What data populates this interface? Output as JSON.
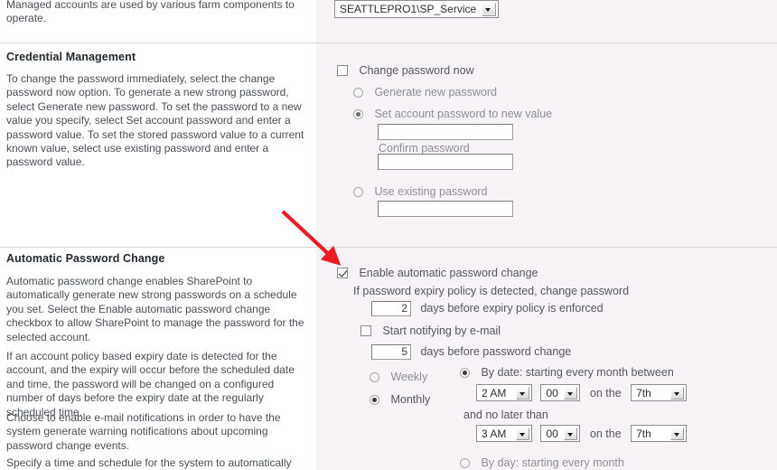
{
  "left_column": {
    "intro_text": "Managed accounts are used by various farm components to operate.",
    "sections": [
      {
        "title": "Credential Management",
        "paragraphs": [
          "To change the password immediately, select the change password now option. To generate a new strong password, select Generate new password. To set the password to a new value you specify, select Set account password and enter a password value. To set the stored password value to a current known value, select use existing password and enter a password value."
        ]
      },
      {
        "title": "Automatic Password Change",
        "paragraphs": [
          "Automatic password change enables SharePoint to automatically generate new strong passwords on a schedule you set. Select the Enable automatic password change checkbox to allow SharePoint to manage the password for the selected account.",
          "If an account policy based expiry date is detected for the account, and the expiry will occur before the scheduled date and time, the password will be changed on a configured number of days before the expiry date at the regularly scheduled time.",
          "Choose to enable e-mail notifications in order to have the system generate warning notifications about upcoming password change events.",
          "Specify a time and schedule for the system to automatically"
        ]
      }
    ]
  },
  "right_column": {
    "account_select": {
      "value": "SEATTLEPRO1\\SP_Service"
    },
    "credential_management": {
      "change_password_now": {
        "label": "Change password now",
        "checked": false
      },
      "generate_new_password": {
        "label": "Generate new password",
        "selected": false
      },
      "set_account_password": {
        "label": "Set account password to new value",
        "selected": true
      },
      "new_password_field": {
        "value": "",
        "placeholder": ""
      },
      "confirm_password_label": "Confirm password",
      "confirm_password_field": {
        "value": "",
        "placeholder": ""
      },
      "use_existing_password": {
        "label": "Use existing password",
        "selected": false
      },
      "existing_password_field": {
        "value": "",
        "placeholder": ""
      }
    },
    "automatic_password_change": {
      "enable": {
        "label": "Enable automatic password change",
        "checked": true
      },
      "expiry_policy_text": "If password expiry policy is detected, change password",
      "expiry_days": {
        "value": "2"
      },
      "expiry_days_suffix": "days before expiry policy is enforced",
      "start_notifying": {
        "label": "Start notifying by e-mail",
        "checked": false
      },
      "notify_days": {
        "value": "5"
      },
      "notify_days_suffix": "days before password change",
      "weekly": {
        "label": "Weekly",
        "selected": false
      },
      "monthly": {
        "label": "Monthly",
        "selected": true
      },
      "by_date": {
        "label": "By date: starting every month between",
        "selected": true,
        "start": {
          "hour": "2 AM",
          "minute": "00",
          "on_the_label": "on the",
          "day": "7th"
        },
        "no_later_than_label": "and no later than",
        "end": {
          "hour": "3 AM",
          "minute": "00",
          "on_the_label": "on the",
          "day": "7th"
        }
      },
      "by_day": {
        "label": "By day: starting every month",
        "selected": false
      }
    }
  },
  "annotation": {
    "arrow_color": "#ED1C24",
    "points_to": "enable-automatic-password-change-checkbox"
  }
}
